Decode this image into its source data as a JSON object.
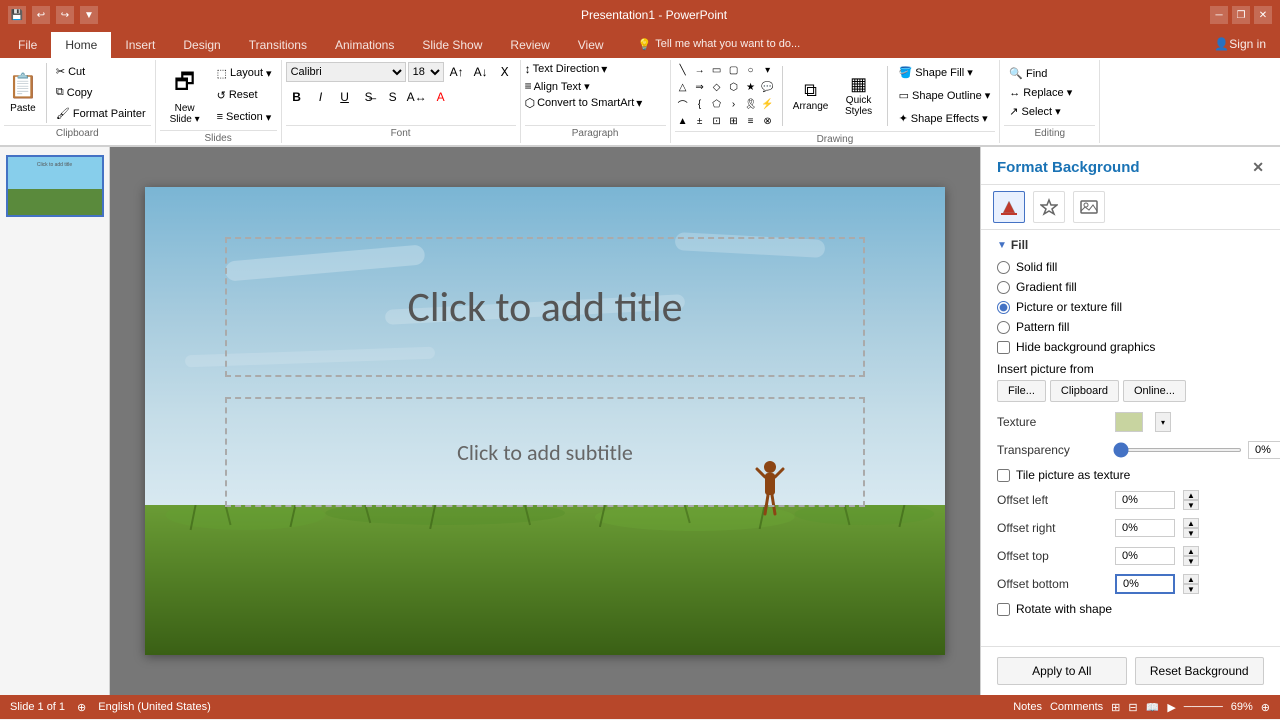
{
  "titlebar": {
    "title": "Presentation1 - PowerPoint",
    "undo_icon": "↩",
    "redo_icon": "↪"
  },
  "ribbon": {
    "tabs": [
      {
        "id": "file",
        "label": "File"
      },
      {
        "id": "home",
        "label": "Home",
        "active": true
      },
      {
        "id": "insert",
        "label": "Insert"
      },
      {
        "id": "design",
        "label": "Design"
      },
      {
        "id": "transitions",
        "label": "Transitions"
      },
      {
        "id": "animations",
        "label": "Animations"
      },
      {
        "id": "slideshow",
        "label": "Slide Show"
      },
      {
        "id": "review",
        "label": "Review"
      },
      {
        "id": "view",
        "label": "View"
      }
    ],
    "tell_me": "Tell me what you want to do...",
    "sign_in": "Sign in",
    "groups": {
      "clipboard": {
        "label": "Clipboard",
        "paste_label": "Paste",
        "cut_label": "Cut",
        "copy_label": "Copy",
        "format_painter_label": "Format Painter"
      },
      "slides": {
        "label": "Slides",
        "new_slide_label": "New\nSlide",
        "layout_label": "Layout",
        "reset_label": "Reset",
        "section_label": "Section"
      },
      "font": {
        "label": "Font",
        "font_name": "Calibri",
        "font_size": "18",
        "bold": "B",
        "italic": "I",
        "underline": "U"
      },
      "paragraph": {
        "label": "Paragraph",
        "text_direction_label": "Text Direction",
        "align_text_label": "Align Text ▾",
        "convert_smartart_label": "Convert to SmartArt"
      },
      "drawing": {
        "label": "Drawing",
        "shape_fill_label": "Shape Fill ▾",
        "shape_outline_label": "Shape Outline ▾",
        "shape_effects_label": "Shape Effects ▾",
        "arrange_label": "Arrange",
        "quick_styles_label": "Quick\nStyles"
      },
      "editing": {
        "label": "Editing",
        "find_label": "Find",
        "replace_label": "Replace ▾",
        "select_label": "Select ▾"
      }
    }
  },
  "format_background": {
    "title": "Format Background",
    "tabs": [
      {
        "id": "fill",
        "icon": "🎨",
        "label": "Fill"
      },
      {
        "id": "effects",
        "icon": "⬡",
        "label": "Effects"
      },
      {
        "id": "picture",
        "icon": "🖼",
        "label": "Picture"
      }
    ],
    "fill_section": {
      "label": "Fill",
      "options": [
        {
          "id": "solid",
          "label": "Solid fill"
        },
        {
          "id": "gradient",
          "label": "Gradient fill"
        },
        {
          "id": "picture_texture",
          "label": "Picture or texture fill",
          "selected": true
        },
        {
          "id": "pattern",
          "label": "Pattern fill"
        }
      ],
      "hide_bg_graphics": "Hide background graphics"
    },
    "insert_picture": {
      "label": "Insert picture from",
      "file_btn": "File...",
      "clipboard_btn": "Clipboard",
      "online_btn": "Online..."
    },
    "texture": {
      "label": "Texture"
    },
    "transparency": {
      "label": "Transparency",
      "value": "0%"
    },
    "tile_picture": "Tile picture as texture",
    "offsets": {
      "offset_left": {
        "label": "Offset left",
        "value": "0%"
      },
      "offset_right": {
        "label": "Offset right",
        "value": "0%"
      },
      "offset_top": {
        "label": "Offset top",
        "value": "0%"
      },
      "offset_bottom": {
        "label": "Offset bottom",
        "value": "0%"
      }
    },
    "rotate_with_shape": "Rotate with shape",
    "apply_to_all": "Apply to All",
    "reset_background": "Reset Background"
  },
  "slide": {
    "title_placeholder": "Click to add title",
    "subtitle_placeholder": "Click to add subtitle"
  },
  "statusbar": {
    "slide_count": "Slide 1 of 1",
    "language": "English (United States)",
    "notes": "Notes",
    "comments": "Comments",
    "zoom": "△"
  }
}
